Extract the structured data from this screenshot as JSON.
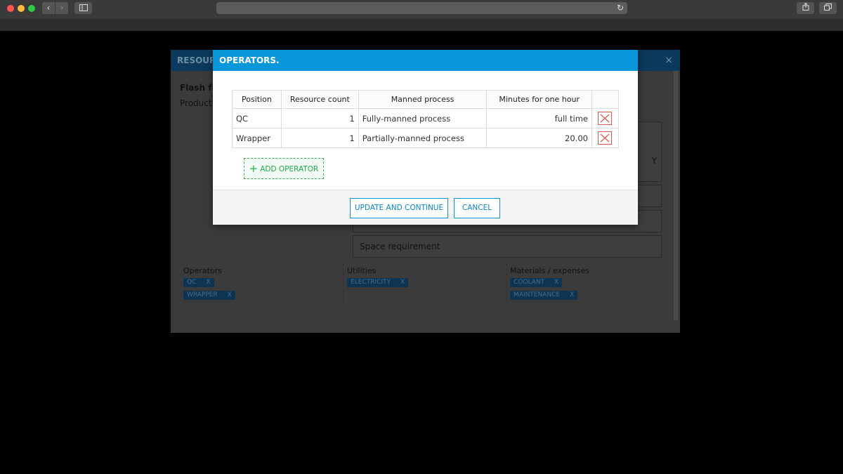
{
  "browser": {
    "back_icon": "chevron-left-icon",
    "forward_icon": "chevron-right-icon",
    "sidebar_icon": "sidebar-icon",
    "reload_icon": "reload-icon",
    "share_icon": "share-icon",
    "tabs_icon": "tabs-icon"
  },
  "background_dialog": {
    "header_title": "RESOURC",
    "close_label": "×",
    "title": "Flash fr",
    "subtitle": "Producti",
    "box_right_text": "Y",
    "space_requirement": "Space requirement",
    "operators_label": "Operators",
    "operators_tags": [
      "QC",
      "WRAPPER"
    ],
    "utilities_label": "Utilities",
    "utilities_tags": [
      "ELECTRICITY"
    ],
    "materials_label": "Materials / expenses",
    "materials_tags": [
      "COOLANT",
      "MAINTENANCE"
    ],
    "tag_remove": "X"
  },
  "modal": {
    "title": "OPERATORS.",
    "table": {
      "headers": [
        "Position",
        "Resource count",
        "Manned process",
        "Minutes for one hour"
      ],
      "rows": [
        {
          "position": "QC",
          "resource_count": "1",
          "manned_process": "Fully-manned process",
          "minutes": "full time"
        },
        {
          "position": "Wrapper",
          "resource_count": "1",
          "manned_process": "Partially-manned process",
          "minutes": "20.00"
        }
      ]
    },
    "add_operator_label": "ADD OPERATOR",
    "update_label": "UPDATE AND CONTINUE",
    "cancel_label": "CANCEL"
  },
  "colors": {
    "modal_header": "#0a97d9",
    "add_button": "#1fae45",
    "delete_icon": "#e2574c"
  }
}
